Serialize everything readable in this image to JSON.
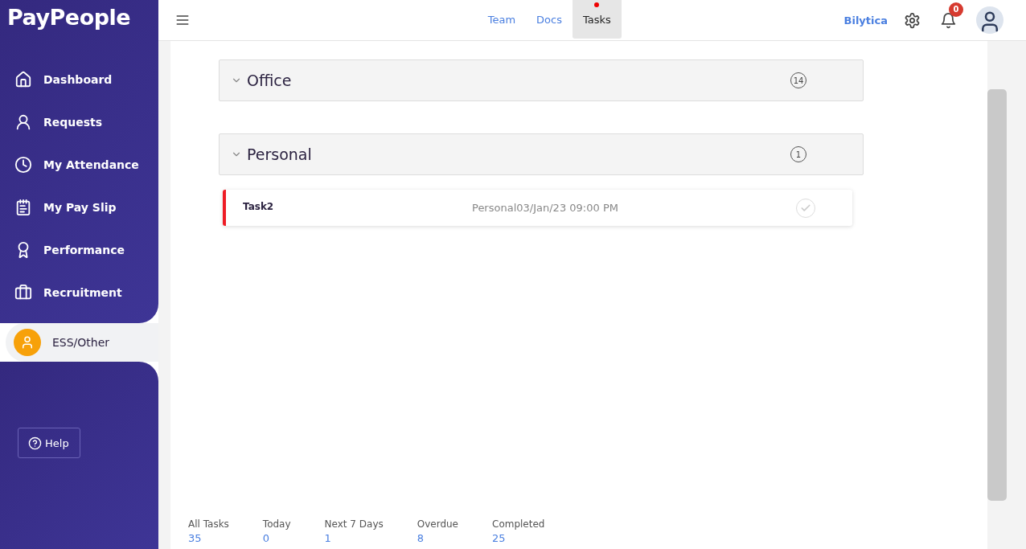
{
  "logo": "PayPeople",
  "sidebar": {
    "items": [
      {
        "label": "Dashboard",
        "selected": false
      },
      {
        "label": "Requests",
        "selected": false
      },
      {
        "label": "My Attendance",
        "selected": false
      },
      {
        "label": "My Pay Slip",
        "selected": false
      },
      {
        "label": "Performance",
        "selected": false
      },
      {
        "label": "Recruitment",
        "selected": false
      },
      {
        "label": "ESS/Other",
        "selected": true
      }
    ],
    "help": "Help"
  },
  "topbar": {
    "tabs": [
      {
        "label": "Team",
        "selected": false
      },
      {
        "label": "Docs",
        "selected": false
      },
      {
        "label": "Tasks",
        "selected": true
      }
    ],
    "company": "Bilytica",
    "notifications": "0"
  },
  "groups": [
    {
      "title": "Office",
      "count": "14",
      "expanded": true
    },
    {
      "title": "Personal",
      "count": "1",
      "expanded": true,
      "tasks": [
        {
          "name": "Task2",
          "category": "Personal",
          "due": "03/Jan/23 09:00 PM",
          "color": "#ee1c25",
          "done": false
        }
      ]
    }
  ],
  "stats": [
    {
      "label": "All Tasks",
      "value": "35"
    },
    {
      "label": "Today",
      "value": "0"
    },
    {
      "label": "Next 7 Days",
      "value": "1"
    },
    {
      "label": "Overdue",
      "value": "8"
    },
    {
      "label": "Completed",
      "value": "25"
    }
  ]
}
